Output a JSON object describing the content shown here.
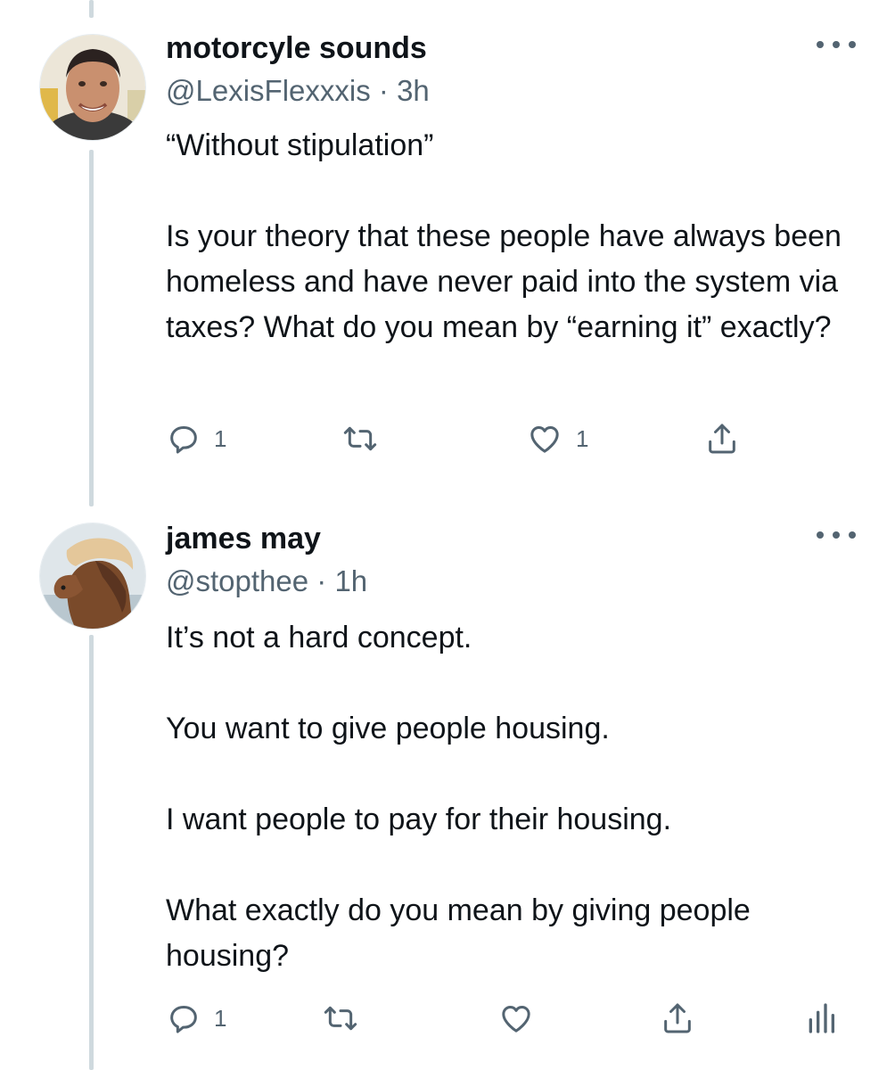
{
  "tweets": [
    {
      "display_name": "motorcyle sounds",
      "handle": "@LexisFlexxxis",
      "separator": "·",
      "time": "3h",
      "text": "“Without stipulation”\n\nIs your theory that these people have always been homeless and have never paid into the system via taxes? What do you mean by “earning it” exactly?",
      "reply_count": "1",
      "retweet_count": "",
      "like_count": "1",
      "icons": [
        "reply-icon",
        "retweet-icon",
        "heart-icon",
        "share-icon"
      ]
    },
    {
      "display_name": "james may",
      "handle": "@stopthee",
      "separator": "·",
      "time": "1h",
      "text": "It’s not a hard concept.\n\nYou want to give people housing.\n\nI want people to pay for their housing.\n\nWhat exactly do you mean by giving people housing?",
      "reply_count": "1",
      "retweet_count": "",
      "like_count": "",
      "icons": [
        "reply-icon",
        "retweet-icon",
        "heart-icon",
        "share-icon",
        "analytics-icon"
      ]
    }
  ],
  "colors": {
    "text": "#0f1419",
    "secondary": "#536471",
    "thread_line": "#cfd9de"
  }
}
